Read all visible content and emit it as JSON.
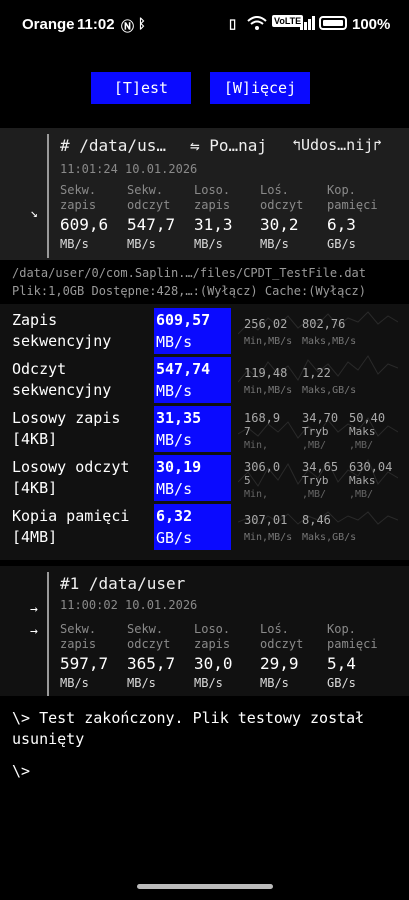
{
  "status_bar": {
    "carrier": "Orange",
    "time": "11:02",
    "battery": "100%",
    "volte": "VoLTE"
  },
  "toolbar": {
    "test_button": "[T]est",
    "more_button": "[W]ięcej"
  },
  "current_result": {
    "title": "#  /data/us…",
    "compare_label": "⇋ Po…naj",
    "share_label": "↰Udos…nij↱",
    "timestamp": "11:01:24 10.01.2026",
    "arrow": "↘",
    "columns": [
      {
        "label1": "Sekw.",
        "label2": "zapis",
        "value": "609,6",
        "unit": "MB/s"
      },
      {
        "label1": "Sekw.",
        "label2": "odczyt",
        "value": "547,7",
        "unit": "MB/s"
      },
      {
        "label1": "Loso.",
        "label2": "zapis",
        "value": "31,3",
        "unit": "MB/s"
      },
      {
        "label1": "Loś.",
        "label2": "odczyt",
        "value": "30,2",
        "unit": "MB/s"
      },
      {
        "label1": "Kop.",
        "label2": "pamięci",
        "value": "6,3",
        "unit": "GB/s"
      }
    ]
  },
  "test_info": {
    "path": "/data/user/0/com.Saplin.…/files/CPDT_TestFile.dat",
    "details": "Plik:1,0GB Dostępne:428,…:(Wyłącz) Cache:(Wyłącz)"
  },
  "tests": [
    {
      "label1": "Zapis",
      "label2": "sekwencyjny",
      "value": "609,57",
      "unit": "MB/s",
      "stats": [
        {
          "v": "256,02",
          "u": "Min,MB/s"
        },
        {
          "v": "802,76",
          "u": "Maks,MB/s"
        }
      ]
    },
    {
      "label1": "Odczyt",
      "label2": "sekwencyjny",
      "value": "547,74",
      "unit": "MB/s",
      "stats": [
        {
          "v": "119,48",
          "u": "Min,MB/s"
        },
        {
          "v": "1,22",
          "u": "Maks,GB/s"
        }
      ]
    },
    {
      "label1": "Losowy zapis",
      "label2": "[4KB]",
      "value": "31,35",
      "unit": "MB/s",
      "stats": [
        {
          "v": "168,9",
          "v2": "7",
          "u": "Min,"
        },
        {
          "v": "34,70",
          "v2": "Tryb",
          "u": ",MB/"
        },
        {
          "v": "50,40",
          "v2": "Maks",
          "u": ",MB/"
        }
      ]
    },
    {
      "label1": "Losowy odczyt",
      "label2": "[4KB]",
      "value": "30,19",
      "unit": "MB/s",
      "stats": [
        {
          "v": "306,0",
          "v2": "5",
          "u": "Min,"
        },
        {
          "v": "34,65",
          "v2": "Tryb",
          "u": ",MB/"
        },
        {
          "v": "630,04",
          "v2": "Maks",
          "u": ",MB/"
        }
      ]
    },
    {
      "label1": "Kopia pamięci",
      "label2": "[4MB]",
      "value": "6,32",
      "unit": "GB/s",
      "stats": [
        {
          "v": "307,01",
          "u": "Min,MB/s"
        },
        {
          "v": "8,46",
          "u": "Maks,GB/s"
        }
      ]
    }
  ],
  "previous_result": {
    "title": "#1 /data/user",
    "timestamp": "11:00:02 10.01.2026",
    "arrow": "→",
    "columns": [
      {
        "label1": "Sekw.",
        "label2": "zapis",
        "value": "597,7",
        "unit": "MB/s"
      },
      {
        "label1": "Sekw.",
        "label2": "odczyt",
        "value": "365,7",
        "unit": "MB/s"
      },
      {
        "label1": "Loso.",
        "label2": "zapis",
        "value": "30,0",
        "unit": "MB/s"
      },
      {
        "label1": "Loś.",
        "label2": "odczyt",
        "value": "29,9",
        "unit": "MB/s"
      },
      {
        "label1": "Kop.",
        "label2": "pamięci",
        "value": "5,4",
        "unit": "GB/s"
      }
    ]
  },
  "console": {
    "line1": "\\> Test zakończony. Plik testowy został",
    "line2": "usunięty",
    "prompt": "\\>"
  },
  "colors": {
    "accent": "#0a0aff",
    "card": "#1e1e1e",
    "background": "#000000"
  }
}
